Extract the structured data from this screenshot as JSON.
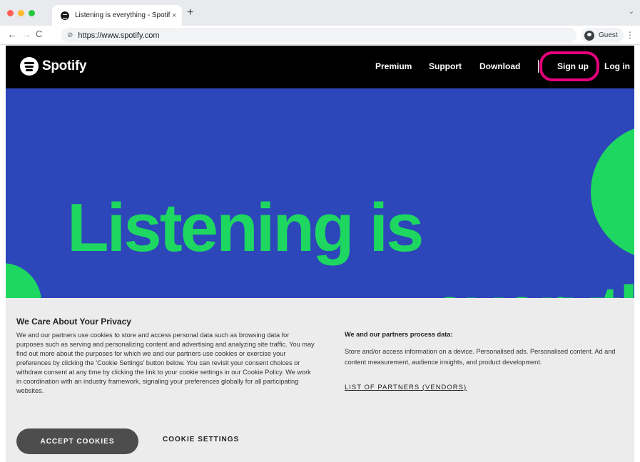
{
  "browser": {
    "tab": {
      "title": "Listening is everything - Spotif",
      "close_glyph": "×",
      "favicon": "spotify-icon"
    },
    "new_tab_glyph": "+",
    "tab_menu_glyph": "⌄",
    "nav": {
      "back_glyph": "←",
      "forward_glyph": "→",
      "reload_glyph": "C"
    },
    "address": {
      "url": "https://www.spotify.com",
      "icon": "site-info-icon"
    },
    "profile": {
      "label": "Guest",
      "icon": "guest-avatar-icon"
    },
    "menu_glyph": "⋮"
  },
  "site": {
    "logo_text": "Spotify",
    "nav": {
      "premium": "Premium",
      "support": "Support",
      "download": "Download",
      "signup": "Sign up",
      "login": "Log in"
    },
    "highlight_color": "#e4007c"
  },
  "hero": {
    "headline": "Listening is",
    "next_line_partial": "everything",
    "colors": {
      "background": "#2d46b9",
      "accent": "#1ed760"
    }
  },
  "cookie": {
    "title": "We Care About Your Privacy",
    "body": "We and our partners use cookies to store and access personal data such as browsing data for purposes such as serving and personalizing content and advertising and analyzing site traffic. You may find out more about the purposes for which we and our partners use cookies or exercise your preferences by clicking the 'Cookie Settings' button below. You can revisit your consent choices or withdraw consent at any time by clicking the link to your cookie settings in our Cookie Policy. We work in coordination with an industry framework, signaling your preferences globally for all participating websites.",
    "process_title": "We and our partners process data:",
    "process_body": "Store and/or access information on a device. Personalised ads. Personalised content. Ad and content measurement, audience insights, and product development.",
    "partners_link": "LIST OF PARTNERS (VENDORS)",
    "accept_label": "ACCEPT COOKIES",
    "settings_label": "COOKIE SETTINGS"
  }
}
